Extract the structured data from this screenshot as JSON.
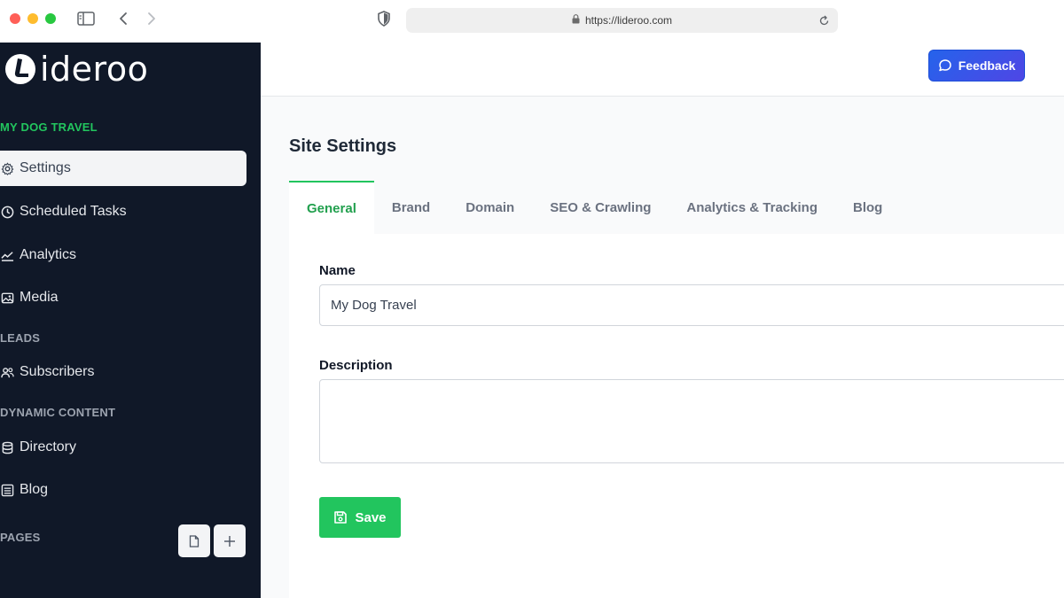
{
  "browser": {
    "url": "https://lideroo.com"
  },
  "sidebar": {
    "logo_text": "ideroo",
    "site_name": "MY DOG TRAVEL",
    "items": [
      {
        "label": "Settings",
        "icon": "gear-icon",
        "active": true
      },
      {
        "label": "Scheduled Tasks",
        "icon": "clock-icon"
      },
      {
        "label": "Analytics",
        "icon": "chart-line-icon"
      },
      {
        "label": "Media",
        "icon": "images-icon"
      }
    ],
    "leads_label": "LEADS",
    "leads_items": [
      {
        "label": "Subscribers",
        "icon": "users-icon"
      }
    ],
    "dynamic_label": "DYNAMIC CONTENT",
    "dynamic_items": [
      {
        "label": "Directory",
        "icon": "database-icon"
      },
      {
        "label": "Blog",
        "icon": "list-icon"
      }
    ],
    "pages_label": "PAGES"
  },
  "topbar": {
    "feedback_label": "Feedback",
    "accent": "#3b4cf6"
  },
  "main": {
    "title": "Site Settings",
    "tabs": [
      {
        "label": "General",
        "active": true
      },
      {
        "label": "Brand"
      },
      {
        "label": "Domain"
      },
      {
        "label": "SEO & Crawling"
      },
      {
        "label": "Analytics & Tracking"
      },
      {
        "label": "Blog"
      }
    ],
    "form": {
      "name_label": "Name",
      "name_value": "My Dog Travel",
      "description_label": "Description",
      "description_value": "",
      "save_label": "Save"
    }
  },
  "colors": {
    "sidebar_bg": "#101828",
    "brand_green": "#22c55e"
  }
}
